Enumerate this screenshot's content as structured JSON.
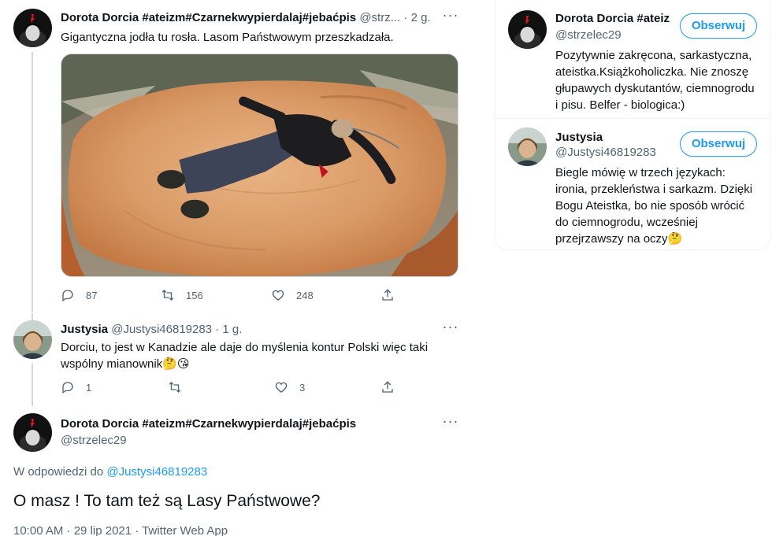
{
  "colors": {
    "accent": "#1d9bf0",
    "text": "#0f1419",
    "muted": "#536471",
    "line": "#cfd9de"
  },
  "tweet1": {
    "name": "Dorota Dorcia #ateizm#Czarnekwypierdalaj#jebaćpis",
    "handle": "@strz...",
    "dot": "·",
    "time": "2 g.",
    "text": "Gigantyczna jodła tu rosła. Lasom Państwowym przeszkadzała.",
    "counts": {
      "replies": "87",
      "retweets": "156",
      "likes": "248"
    }
  },
  "tweet2": {
    "name": "Justysia",
    "handle": "@Justysi46819283",
    "dot": "·",
    "time": "1 g.",
    "text": "Dorciu, to jest w Kanadzie ale daje do myślenia kontur Polski więc taki wspólny mianownik",
    "emoji": "🤔😘",
    "counts": {
      "replies": "1",
      "retweets": "",
      "likes": "3"
    }
  },
  "tweet3": {
    "name": "Dorota Dorcia #ateizm#Czarnekwypierdalaj#jebaćpis",
    "handle": "@strzelec29",
    "reply_prefix": "W odpowiedzi do",
    "reply_mention": "@Justysi46819283",
    "text": "O masz ! To tam też są Lasy Państwowe?",
    "meta": "10:00 AM · 29 lip 2021 · Twitter Web App"
  },
  "sidebar": {
    "users": [
      {
        "name": "Dorota Dorcia #ateiz",
        "handle": "@strzelec29",
        "follow_label": "Obserwuj",
        "bio": "Pozytywnie zakręcona, sarkastyczna, ateistka.Książkoholiczka. Nie znoszę głupawych dyskutantów, ciemnogrodu i pisu. Belfer - biologica:)"
      },
      {
        "name": "Justysia",
        "handle": "@Justysi46819283",
        "follow_label": "Obserwuj",
        "bio": "Biegle mówię w trzech językach: ironia, przekleństwa i sarkazm. Dzięki Bogu Ateistka, bo nie sposób wrócić do ciemnogrodu, wcześniej przejrzawszy na oczy",
        "bio_emoji": "🤔"
      }
    ]
  },
  "icons": [
    "reply-icon",
    "retweet-icon",
    "like-icon",
    "share-icon",
    "more-icon"
  ]
}
